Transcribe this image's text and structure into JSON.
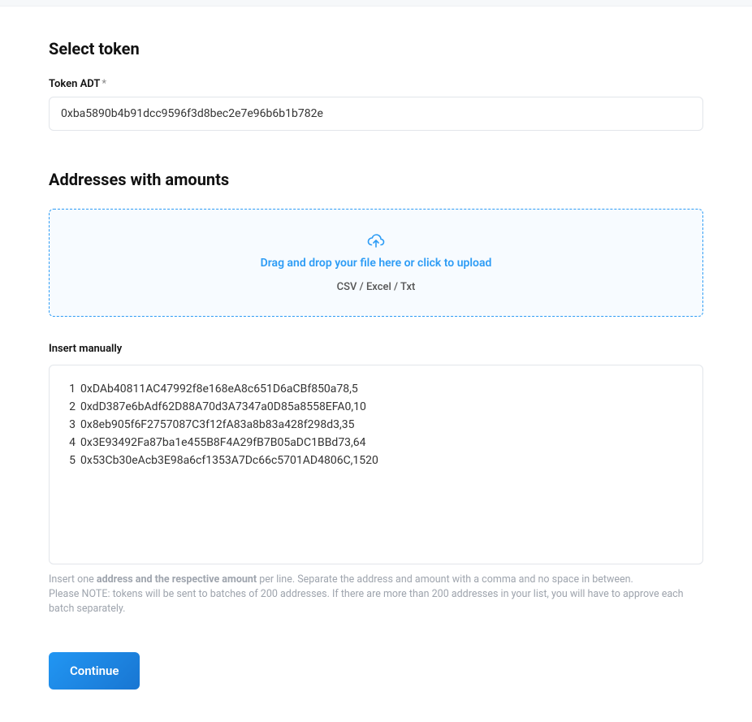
{
  "sections": {
    "select_token": {
      "title": "Select token",
      "field_label": "Token ADT",
      "required_mark": "*",
      "value": "0xba5890b4b91dcc9596f3d8bec2e7e96b6b1b782e"
    },
    "addresses": {
      "title": "Addresses with amounts",
      "dropzone": {
        "text": "Drag and drop your file here or click to upload",
        "hint": "CSV / Excel / Txt"
      },
      "manual": {
        "label": "Insert manually",
        "lines": [
          "0xDAb40811AC47992f8e168eA8c651D6aCBf850a78,5",
          "0xdD387e6bAdf62D88A70d3A7347a0D85a8558EFA0,10",
          "0x8eb905f6F2757087C3f12fA83a8b83a428f298d3,35",
          "0x3E93492Fa87ba1e455B8F4A29fB7B05aDC1BBd73,64",
          "0x53Cb30eAcb3E98a6cf1353A7Dc66c5701AD4806C,1520"
        ]
      },
      "help": {
        "line1_pre": "Insert one ",
        "line1_bold": "address and the respective amount",
        "line1_post": " per line. Separate the address and amount with a comma and no space in between.",
        "line2": "Please NOTE: tokens will be sent to batches of 200 addresses. If there are more than 200 addresses in your list, you will have to approve each batch separately."
      }
    }
  },
  "actions": {
    "continue_label": "Continue"
  }
}
